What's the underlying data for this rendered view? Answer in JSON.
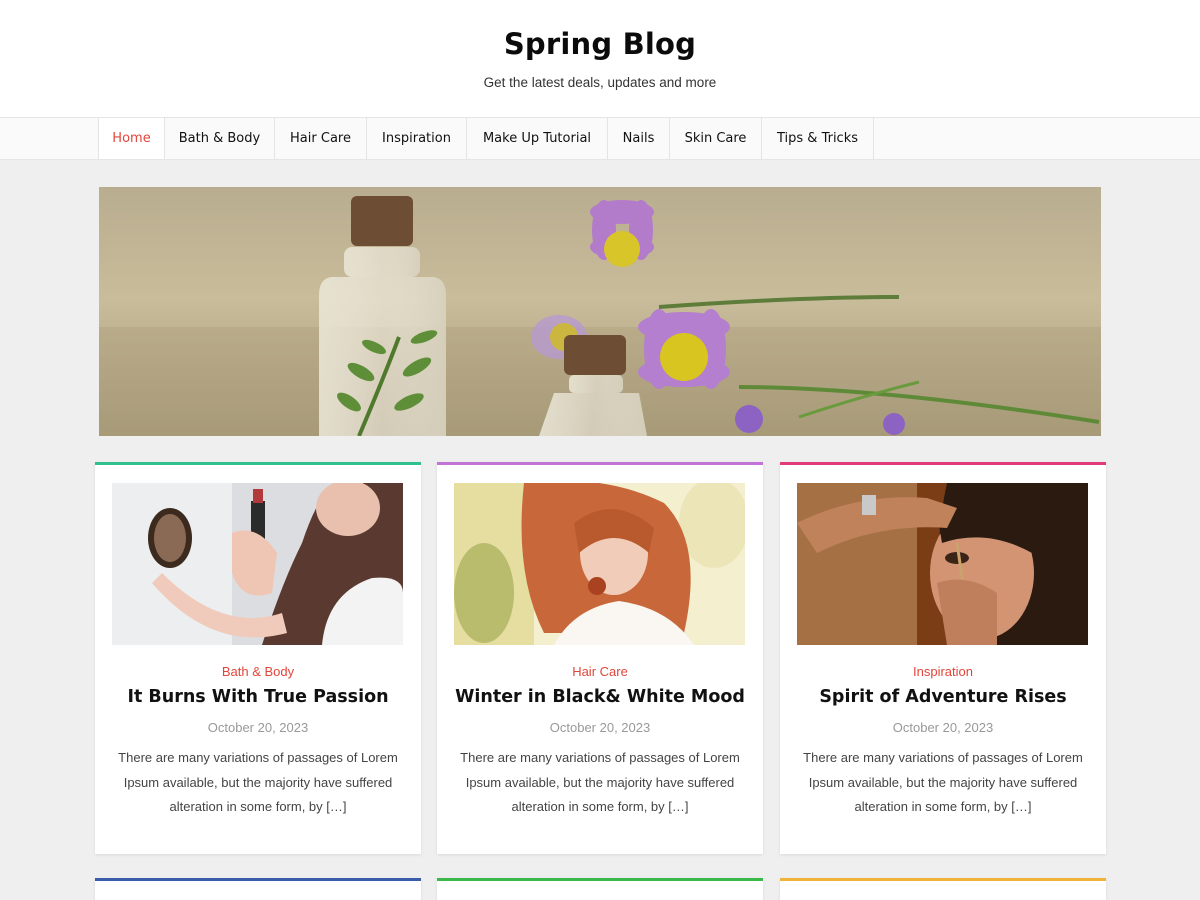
{
  "header": {
    "title": "Spring Blog",
    "tagline": "Get the latest deals, updates and more"
  },
  "nav": {
    "items": [
      {
        "label": "Home",
        "active": true
      },
      {
        "label": "Bath & Body"
      },
      {
        "label": "Hair Care"
      },
      {
        "label": "Inspiration"
      },
      {
        "label": "Make Up Tutorial"
      },
      {
        "label": "Nails"
      },
      {
        "label": "Skin Care"
      },
      {
        "label": "Tips & Tricks"
      }
    ]
  },
  "hero": {
    "image": "perfume-bottles-and-flowers"
  },
  "posts": [
    {
      "category": "Bath & Body",
      "title": "It Burns With True Passion",
      "date": "October 20, 2023",
      "excerpt": "There are many variations of passages of Lorem Ipsum available, but the majority have suffered alteration in some form, by […]",
      "accent": "#2ec08f",
      "image": "woman-with-lipstick-and-mirror"
    },
    {
      "category": "Hair Care",
      "title": "Winter in Black& White Mood",
      "date": "October 20, 2023",
      "excerpt": "There are many variations of passages of Lorem Ipsum available, but the majority have suffered alteration in some form, by […]",
      "accent": "#c274d6",
      "image": "red-haired-woman"
    },
    {
      "category": "Inspiration",
      "title": "Spirit of Adventure Rises",
      "date": "October 20, 2023",
      "excerpt": "There are many variations of passages of Lorem Ipsum available, but the majority have suffered alteration in some form, by […]",
      "accent": "#e23a7a",
      "image": "eye-makeup-application"
    }
  ],
  "next_row_accents": [
    "#3b5bab",
    "#3bb84a",
    "#f0b33a"
  ],
  "colors": {
    "accent_red": "#e2463a",
    "page_bg": "#efefef"
  }
}
